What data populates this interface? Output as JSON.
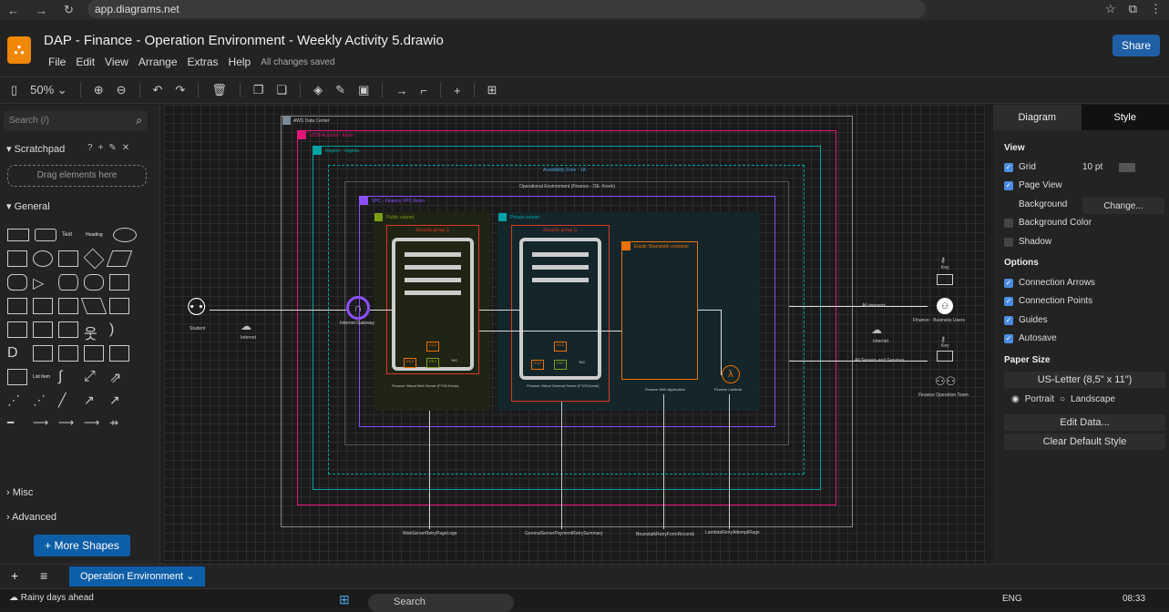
{
  "browser": {
    "url": "app.diagrams.net"
  },
  "app": {
    "title": "DAP - Finance - Operation Environment - Weekly Activity 5.drawio",
    "menus": [
      "File",
      "Edit",
      "View",
      "Arrange",
      "Extras",
      "Help"
    ],
    "save_status": "All changes saved",
    "share_label": "Share",
    "zoom": "50%"
  },
  "sidebar": {
    "search_placeholder": "Search (/)",
    "scratchpad": "Scratchpad",
    "drag_hint": "Drag elements here",
    "general": "General",
    "misc": "Misc",
    "advanced": "Advanced",
    "more_shapes": "+ More Shapes",
    "shape_text": "Text",
    "shape_heading": "Heading",
    "shape_list": "List Item"
  },
  "diagram": {
    "aws_dc": "AWS Data Center",
    "ucw": "UCW Account - Kevin",
    "region": "Region - Virginia",
    "az": "Availability Zone - 1A",
    "openv": "Operational Environment (Finance - OE- Kevin)",
    "vpc": "VPC - Finance VPC Kevin",
    "public_subnet": "Public subnet",
    "private_subnet": "Private subnet",
    "sg1": "Security group ()",
    "sg2": "Security group ()",
    "eb": "Elastic Beanstalk container",
    "student": "Student",
    "internet": "Internet",
    "igw": "Internet Gateway",
    "s1": "Finance Virtual Web Server (FY00-Kevin)",
    "s2": "Finance Virtual General Server (FY00-Kevin)",
    "webapp": "Finance Web Application",
    "lambda": "Finance Lambda",
    "key": "Key",
    "biz": "Finance - Business Users",
    "ops": "Finance Operation Team",
    "all_datasets": "All datasets",
    "all_servers": "All Servers and Services",
    "edge1": "WebServerRetryPageLogs",
    "edge2": "GeneralServerPaymentRetrySummary",
    "edge3": "BeanstalkRetryFormRecords",
    "edge4": "LambdaRetryAttemptFlags",
    "chip_ec2": "EC2",
    "chip_ebs": "EBS",
    "chip_nic": "NIC"
  },
  "format": {
    "tab_diagram": "Diagram",
    "tab_style": "Style",
    "view": "View",
    "grid": "Grid",
    "grid_size": "10 pt",
    "page_view": "Page View",
    "background": "Background",
    "change": "Change...",
    "bg_color": "Background Color",
    "shadow": "Shadow",
    "options": "Options",
    "conn_arrows": "Connection Arrows",
    "conn_points": "Connection Points",
    "guides": "Guides",
    "autosave": "Autosave",
    "paper_size": "Paper Size",
    "paper": "US-Letter (8,5\" x 11\")",
    "portrait": "Portrait",
    "landscape": "Landscape",
    "edit_data": "Edit Data...",
    "clear_style": "Clear Default Style"
  },
  "pages": {
    "current": "Operation Environment"
  },
  "taskbar": {
    "weather": "Rainy days ahead",
    "search": "Search",
    "lang": "ENG",
    "time": "08:33"
  }
}
